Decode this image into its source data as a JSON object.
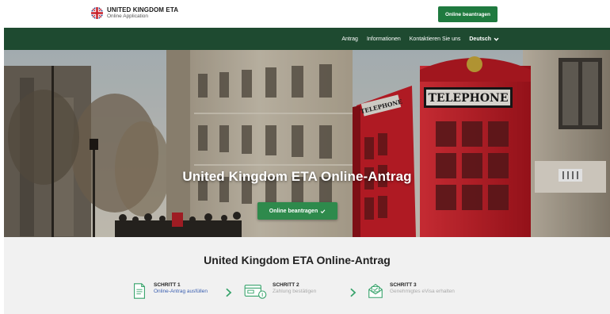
{
  "header": {
    "brand_name": "UNITED KINGDOM ETA",
    "brand_sub": "Online Application",
    "apply_label": "Online beantragen"
  },
  "nav": {
    "items": [
      "Antrag",
      "Informationen",
      "Kontaktieren Sie uns"
    ],
    "language": "Deutsch"
  },
  "hero": {
    "title": "United Kingdom ETA Online-Antrag",
    "button_label": "Online beantragen",
    "booth_sign": "TELEPHONE"
  },
  "steps_section": {
    "title": "United Kingdom ETA Online-Antrag",
    "steps": [
      {
        "label": "SCHRITT 1",
        "desc": "Online-Antrag ausfüllen",
        "state": "active"
      },
      {
        "label": "SCHRITT 2",
        "desc": "Zahlung bestätigen",
        "state": "muted"
      },
      {
        "label": "SCHRITT 3",
        "desc": "Genehmigtes eVisa erhalten",
        "state": "muted"
      }
    ]
  },
  "colors": {
    "brand_green": "#1f7a3f",
    "nav_green": "#1e4a30",
    "hero_button_green": "#2e8a4c",
    "step_accent": "#37a36b",
    "active_link": "#3a5fb0",
    "booth_red": "#c8202a"
  },
  "icons": [
    "uk-flag-icon",
    "chevron-down-icon",
    "check-icon",
    "form-icon",
    "payment-icon",
    "approved-visa-icon",
    "chevron-right-icon"
  ]
}
